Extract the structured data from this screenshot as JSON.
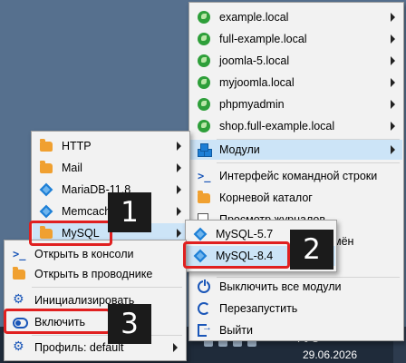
{
  "taskbar": {
    "language": "РУС",
    "date": "29.06.2026"
  },
  "menus": {
    "sites": [
      {
        "label": "example.local",
        "icon": "globe-icon"
      },
      {
        "label": "full-example.local",
        "icon": "globe-icon"
      },
      {
        "label": "joomla-5.local",
        "icon": "globe-icon"
      },
      {
        "label": "myjoomla.local",
        "icon": "globe-icon"
      },
      {
        "label": "phpmyadmin",
        "icon": "globe-icon"
      },
      {
        "label": "shop.full-example.local",
        "icon": "globe-icon"
      }
    ],
    "main": {
      "modules": "Модули",
      "cli": "Интерфейс командной строки",
      "root": "Корневой каталог",
      "logs": "Просмотр журналов",
      "logs_peek": "мён",
      "stop_all": "Выключить все модули",
      "restart": "Перезапустить",
      "exit": "Выйти"
    },
    "modules": [
      "HTTP",
      "Mail",
      "MariaDB-11.8",
      "Memcached",
      "MySQL"
    ],
    "mysql_versions": [
      "MySQL-5.7",
      "MySQL-8.4"
    ],
    "mysql_actions": {
      "open_console": "Открыть в консоли",
      "open_explorer": "Открыть в проводнике",
      "initialize": "Инициализировать",
      "enable": "Включить",
      "profile": "Профиль: default"
    }
  },
  "callouts": [
    "1",
    "2",
    "3"
  ]
}
